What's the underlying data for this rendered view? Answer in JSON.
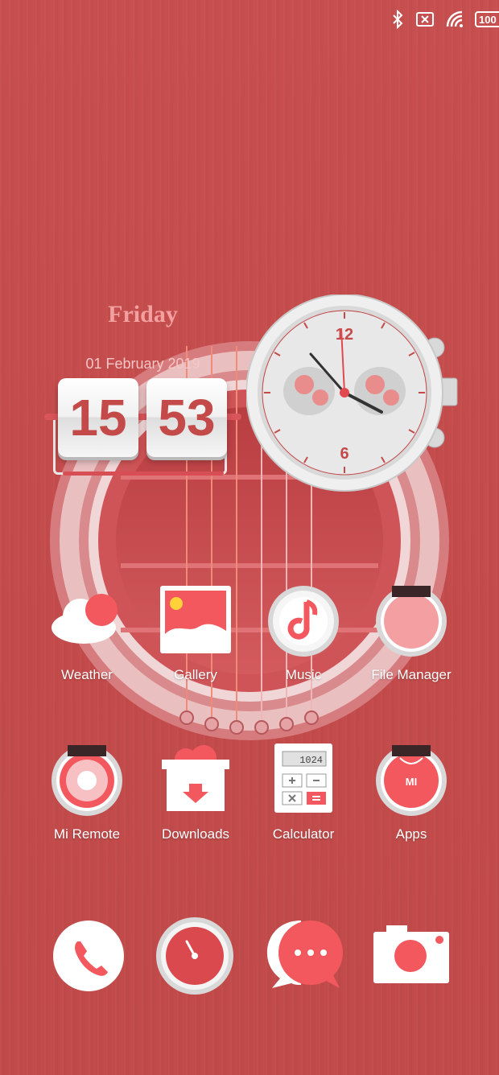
{
  "status_bar": {
    "icons": [
      "bluetooth-icon",
      "sim-off-icon",
      "wifi-icon"
    ],
    "battery": "100"
  },
  "widget": {
    "day": "Friday",
    "date": "01 February 2019",
    "hour": "15",
    "minute": "53"
  },
  "analog_clock": {
    "numeral_top": "12",
    "numeral_bottom": "6"
  },
  "apps": [
    {
      "label": "Weather"
    },
    {
      "label": "Gallery"
    },
    {
      "label": "Music"
    },
    {
      "label": "File Manager"
    },
    {
      "label": "Mi Remote"
    },
    {
      "label": "Downloads"
    },
    {
      "label": "Calculator"
    },
    {
      "label": "Apps"
    }
  ],
  "calculator_display": "1024",
  "apps_logo": "MI",
  "dock": [
    "phone-icon",
    "clock-icon",
    "messages-icon",
    "camera-icon"
  ],
  "colors": {
    "background": "#c64d4d",
    "accent": "#f2585d",
    "white": "#ffffff"
  }
}
